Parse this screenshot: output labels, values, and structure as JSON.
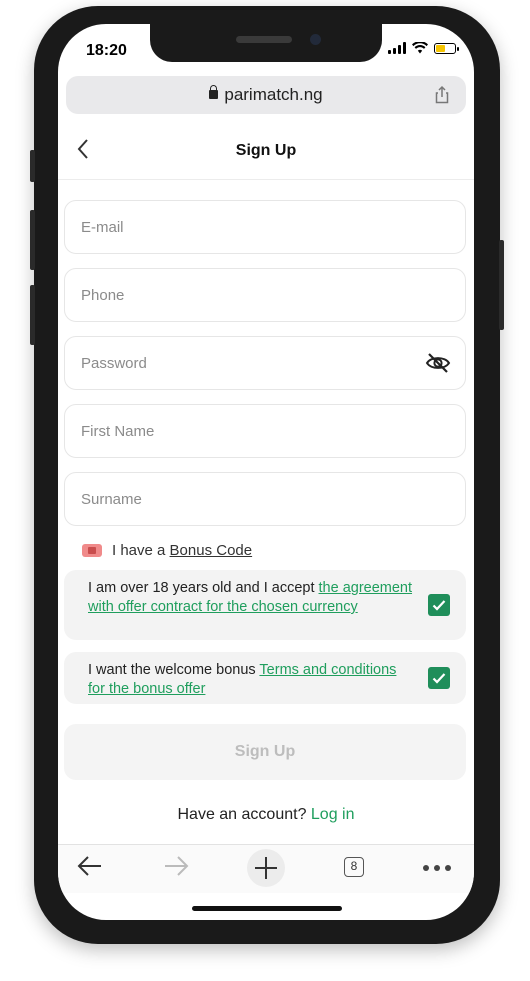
{
  "status_bar": {
    "time": "18:20"
  },
  "browser": {
    "url": "parimatch.ng",
    "tabs_count": "8"
  },
  "header": {
    "title": "Sign Up"
  },
  "form": {
    "email_placeholder": "E-mail",
    "phone_placeholder": "Phone",
    "password_placeholder": "Password",
    "first_name_placeholder": "First Name",
    "surname_placeholder": "Surname"
  },
  "bonus": {
    "prefix": "I have a ",
    "link": "Bonus Code"
  },
  "agreement": {
    "text": "I am over 18 years old and I accept ",
    "link": "the agreement with offer contract for the chosen currency",
    "checked": true
  },
  "welcome_bonus": {
    "text": "I want the welcome bonus ",
    "link": "Terms and conditions for the bonus offer",
    "checked": true
  },
  "submit": {
    "label": "Sign Up"
  },
  "login_prompt": {
    "text": "Have an account? ",
    "link": "Log in"
  },
  "colors": {
    "accent": "#1f9e5d",
    "checkbox": "#1f8e5a"
  }
}
